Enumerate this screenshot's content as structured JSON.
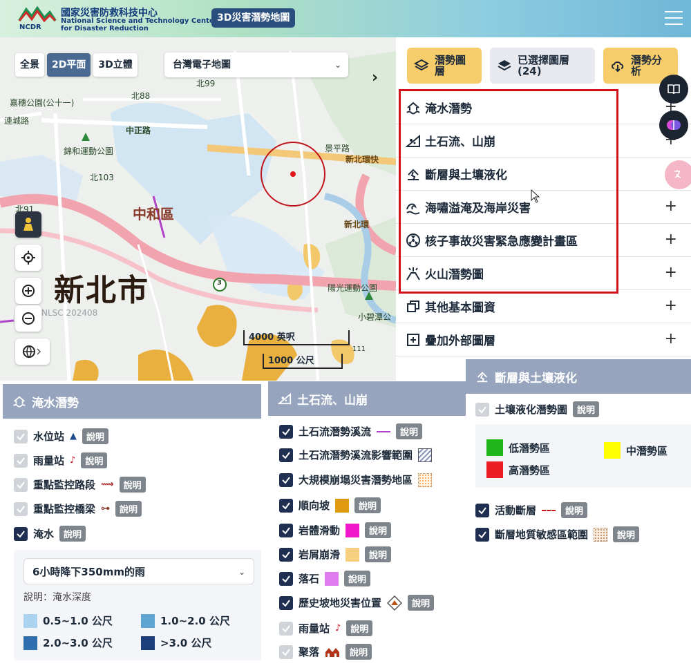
{
  "header": {
    "org_zh": "國家災害防救科技中心",
    "org_en_1": "National Science and Technology Center",
    "org_en_2": "for Disaster Reduction",
    "logo_text": "NCDR",
    "app_title": "3D災害潛勢地圖"
  },
  "map": {
    "view_tabs": [
      "全景",
      "2D平面",
      "3D立體"
    ],
    "active_tab": "2D平面",
    "basemap": "台灣電子地圖",
    "city_label": "新北市",
    "district_label": "中和區",
    "labels": {
      "park1": "錦和運動公園",
      "park2": "陽光運動公園",
      "lake": "小碧潭公",
      "road_zhongzheng": "中正路",
      "road_xinbei": "新北環快",
      "road_xinbei2": "新北環",
      "road_88": "北88",
      "road_99": "北99",
      "road_91": "北91",
      "road_103": "北103",
      "school": "嘉穗公園(公十一)",
      "road_lian": "連城路",
      "road_jingping": "景平路",
      "nlsc": "NLSC 202408",
      "hw3": "3",
      "hw111": "111"
    },
    "scale_ft": "4000 英呎",
    "scale_m": "1000 公尺"
  },
  "right_panel": {
    "btn_potential": "潛勢圖層",
    "btn_selected": "已選擇圖層",
    "btn_selected_count": "(24)",
    "btn_analysis": "潛勢分析",
    "categories": [
      {
        "label": "淹水潛勢",
        "icon": "flood-house-icon"
      },
      {
        "label": "土石流、山崩",
        "icon": "landslide-icon"
      },
      {
        "label": "斷層與土壤液化",
        "icon": "fault-icon"
      },
      {
        "label": "海嘯溢淹及海岸災害",
        "icon": "tsunami-icon"
      },
      {
        "label": "核子事故災害緊急應變計畫區",
        "icon": "nuclear-icon"
      },
      {
        "label": "火山潛勢圖",
        "icon": "volcano-icon"
      },
      {
        "label": "其他基本圖資",
        "icon": "layers-icon"
      },
      {
        "label": "疊加外部圖層",
        "icon": "add-box-icon"
      }
    ]
  },
  "flood_panel": {
    "title": "淹水潛勢",
    "desc_label": "說明",
    "items": [
      {
        "label": "水位站",
        "checked": false
      },
      {
        "label": "雨量站",
        "checked": false
      },
      {
        "label": "重點監控路段",
        "checked": false
      },
      {
        "label": "重點監控橋梁",
        "checked": false
      },
      {
        "label": "淹水",
        "checked": true
      }
    ],
    "depth_select": "6小時降下350mm的雨",
    "depth_desc": "說明：淹水深度",
    "legend": [
      {
        "label": "0.5~1.0 公尺",
        "color": "#a9d3ef"
      },
      {
        "label": "1.0~2.0 公尺",
        "color": "#5fa5d2"
      },
      {
        "label": "2.0~3.0 公尺",
        "color": "#2f6fb0"
      },
      {
        "label": ">3.0 公尺",
        "color": "#1c3f7c"
      }
    ]
  },
  "landslide_panel": {
    "title": "土石流、山崩",
    "desc_label": "說明",
    "items": [
      {
        "label": "土石流潛勢溪流",
        "checked": true
      },
      {
        "label": "土石流潛勢溪流影響範圍",
        "checked": true
      },
      {
        "label": "大規模崩塌災害潛勢地區",
        "checked": true
      },
      {
        "label": "順向坡",
        "checked": true,
        "color": "#e09a12"
      },
      {
        "label": "岩體滑動",
        "checked": true,
        "color": "#ee18c8"
      },
      {
        "label": "岩屑崩滑",
        "checked": true,
        "color": "#f6cf80"
      },
      {
        "label": "落石",
        "checked": true,
        "color": "#e07cf0"
      },
      {
        "label": "歷史坡地災害位置",
        "checked": true
      },
      {
        "label": "雨量站",
        "checked": false
      },
      {
        "label": "聚落",
        "checked": false
      }
    ]
  },
  "fault_panel": {
    "title": "斷層與土壤液化",
    "desc_label": "說明",
    "liquefaction": {
      "label": "土壤液化潛勢圖",
      "checked": false
    },
    "legend": [
      {
        "label": "低潛勢區",
        "color": "#22b51a"
      },
      {
        "label": "中潛勢區",
        "color": "#ffff00"
      },
      {
        "label": "高潛勢區",
        "color": "#ee1c24"
      }
    ],
    "items": [
      {
        "label": "活動斷層",
        "checked": true
      },
      {
        "label": "斷層地質敏感區範圍",
        "checked": true
      }
    ]
  }
}
